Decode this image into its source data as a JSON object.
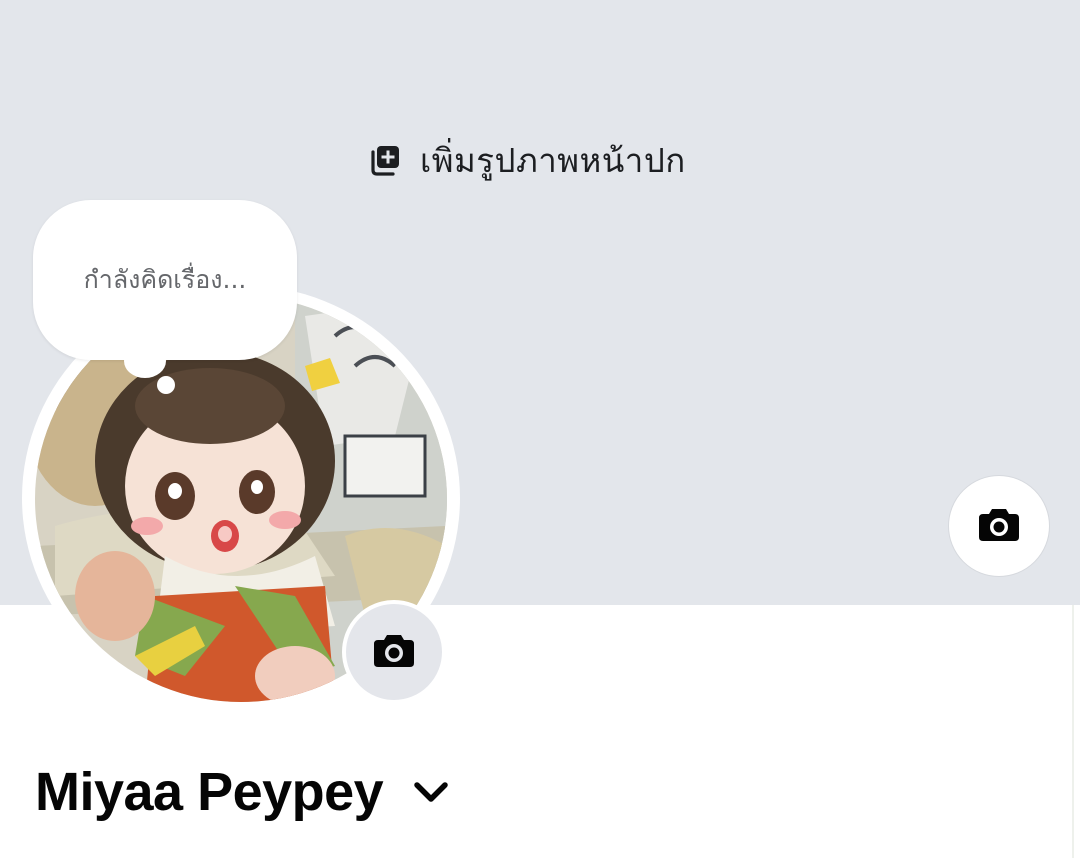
{
  "cover": {
    "add_cover_label": "เพิ่มรูปภาพหน้าปก",
    "background_color": "#e3e6eb",
    "add_cover_icon": "add-photo-icon",
    "camera_icon": "camera-icon"
  },
  "note_bubble": {
    "placeholder": "กำลังคิดเรื่อง..."
  },
  "profile": {
    "name": "Miyaa Peypey",
    "name_menu_icon": "chevron-down-icon",
    "avatar_camera_icon": "camera-icon"
  }
}
